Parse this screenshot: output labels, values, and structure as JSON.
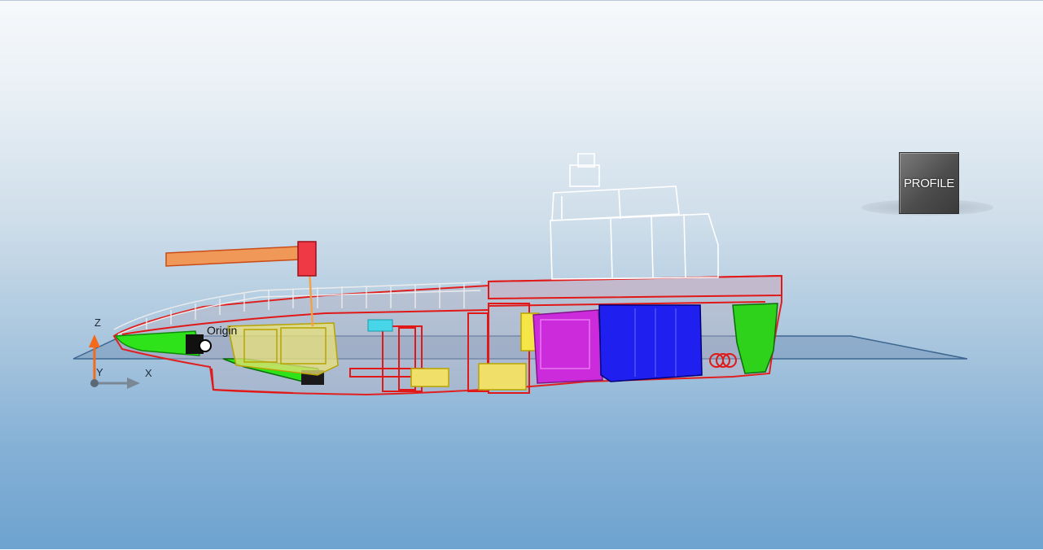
{
  "view_cube": {
    "label": "PROFILE"
  },
  "origin": {
    "label": "Origin"
  },
  "axes": {
    "z": "Z",
    "y": "Y",
    "x": "X"
  }
}
